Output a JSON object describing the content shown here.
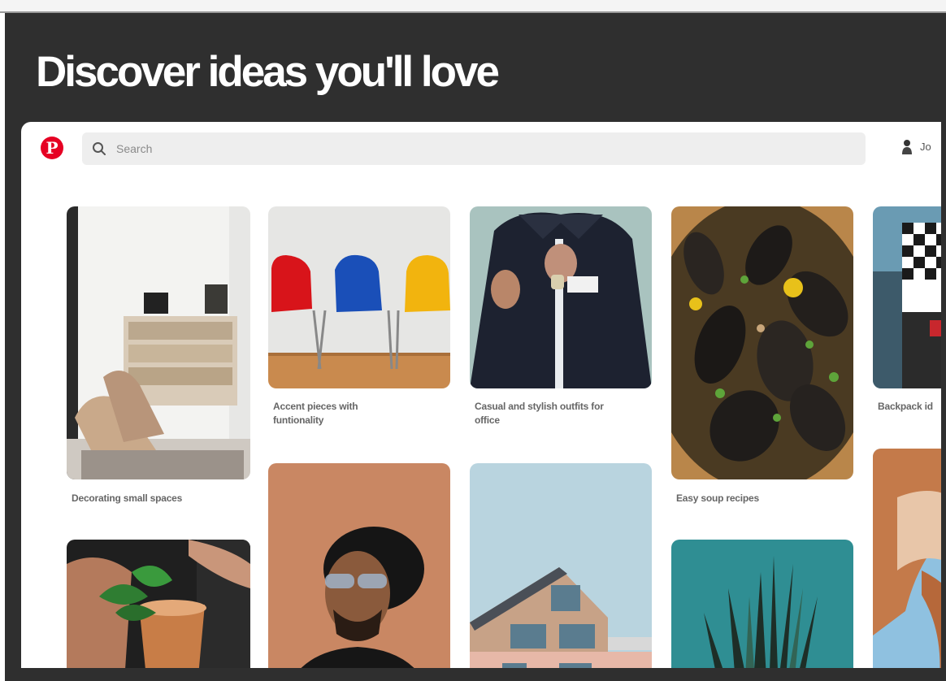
{
  "hero": {
    "title": "Discover ideas you'll love"
  },
  "topbar": {
    "search_placeholder": "Search",
    "user_name": "Jo"
  },
  "pins": [
    {
      "caption": "Decorating small spaces",
      "image": "living-room-shelves"
    },
    {
      "caption": "Accent pieces with funtionality",
      "image": "colorful-chairs"
    },
    {
      "caption": "Casual and stylish outfits for office",
      "image": "man-buttoning-shirt"
    },
    {
      "caption": "Easy soup recipes",
      "image": "mussels-dish"
    },
    {
      "caption": "Backpack id",
      "image": "checkered-backpack"
    },
    {
      "caption": "",
      "image": "mint-cocktail"
    },
    {
      "caption": "",
      "image": "man-with-hat"
    },
    {
      "caption": "",
      "image": "building-facade"
    },
    {
      "caption": "",
      "image": "spiky-plant"
    },
    {
      "caption": "",
      "image": "arch-rock"
    }
  ],
  "colors": {
    "brand": "#e60023",
    "hero_bg": "#2f2f2f",
    "search_bg": "#eeeeee"
  }
}
